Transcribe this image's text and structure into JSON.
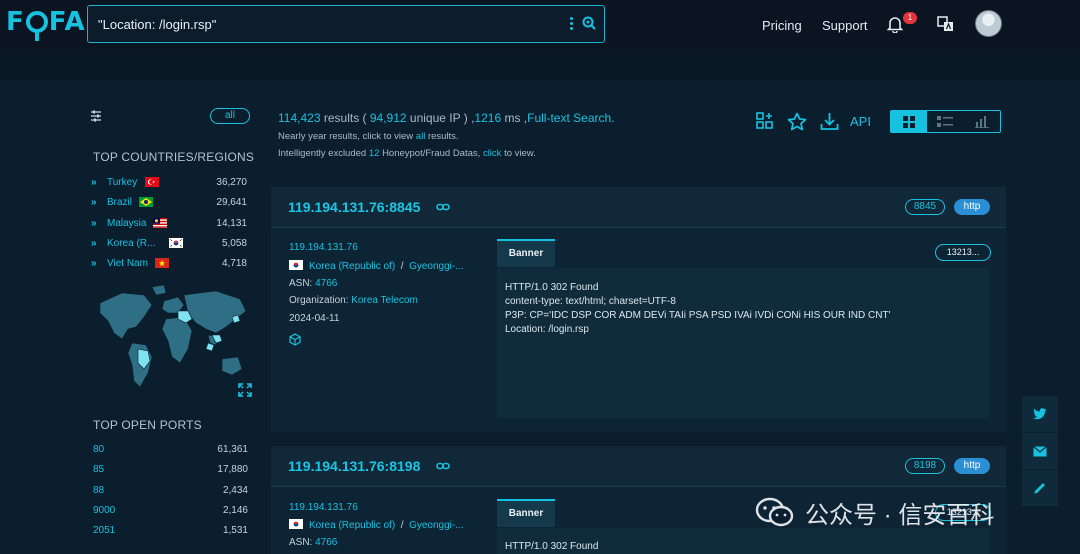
{
  "header": {
    "logo": "FOFA",
    "search_query": "\"Location: /login.rsp\"",
    "nav_pricing": "Pricing",
    "nav_support": "Support",
    "notification_count": "1"
  },
  "sidebar": {
    "all_label": "all",
    "countries_title": "TOP COUNTRIES/REGIONS",
    "countries": [
      {
        "name": "Turkey",
        "count": "36,270",
        "flag": "turkey"
      },
      {
        "name": "Brazil",
        "count": "29,641",
        "flag": "brazil"
      },
      {
        "name": "Malaysia",
        "count": "14,131",
        "flag": "malaysia"
      },
      {
        "name": "Korea (R...",
        "count": "5,058",
        "flag": "korea"
      },
      {
        "name": "Viet Nam",
        "count": "4,718",
        "flag": "vietnam"
      }
    ],
    "ports_title": "TOP OPEN PORTS",
    "ports": [
      {
        "port": "80",
        "count": "61,361"
      },
      {
        "port": "85",
        "count": "17,880"
      },
      {
        "port": "88",
        "count": "2,434"
      },
      {
        "port": "9000",
        "count": "2,146"
      },
      {
        "port": "2051",
        "count": "1,531"
      }
    ]
  },
  "results": {
    "count": "114,423",
    "results_label": "results (",
    "unique_ip": "94,912",
    "unique_ip_label": "unique IP ) ,",
    "ms": "1216",
    "ms_label": "ms ,",
    "fulltext": "Full-text Search.",
    "sub1_prefix": "Nearly year results, click to view",
    "sub1_link": "all",
    "sub1_suffix": "results.",
    "sub2_prefix": "Intelligently excluded",
    "sub2_count": "12",
    "sub2_mid": "Honeypot/Fraud Datas,",
    "sub2_link": "click",
    "sub2_suffix": "to view.",
    "api_label": "API"
  },
  "cards": [
    {
      "ip_port": "119.194.131.76:8845",
      "port": "8845",
      "protocol": "http",
      "ip": "119.194.131.76",
      "country": "Korea (Republic of)",
      "separator": "/",
      "region": "Gyeonggi-...",
      "asn_label": "ASN:",
      "asn": "4766",
      "org_label": "Organization:",
      "org": "Korea Telecom",
      "date": "2024-04-11",
      "banner_tab": "Banner",
      "size": "13213...",
      "banner": [
        "HTTP/1.0 302 Found",
        "content-type: text/html; charset=UTF-8",
        "P3P: CP='IDC DSP COR ADM DEVi TAIi PSA PSD IVAi IVDi CONi HIS OUR IND CNT'",
        "Location: /login.rsp"
      ]
    },
    {
      "ip_port": "119.194.131.76:8198",
      "port": "8198",
      "protocol": "http",
      "ip": "119.194.131.76",
      "country": "Korea (Republic of)",
      "separator": "/",
      "region": "Gyeonggi-...",
      "asn_label": "ASN:",
      "asn": "4766",
      "banner_tab": "Banner",
      "size": "13213...",
      "banner": [
        "HTTP/1.0 302 Found"
      ]
    }
  ],
  "watermark": "公众号 · 信安百科",
  "colors": {
    "accent": "#17c2e0",
    "background": "#0b1e2e",
    "card": "#0d2434",
    "http_pill": "#2b8fd6",
    "badge": "#e5323b"
  }
}
